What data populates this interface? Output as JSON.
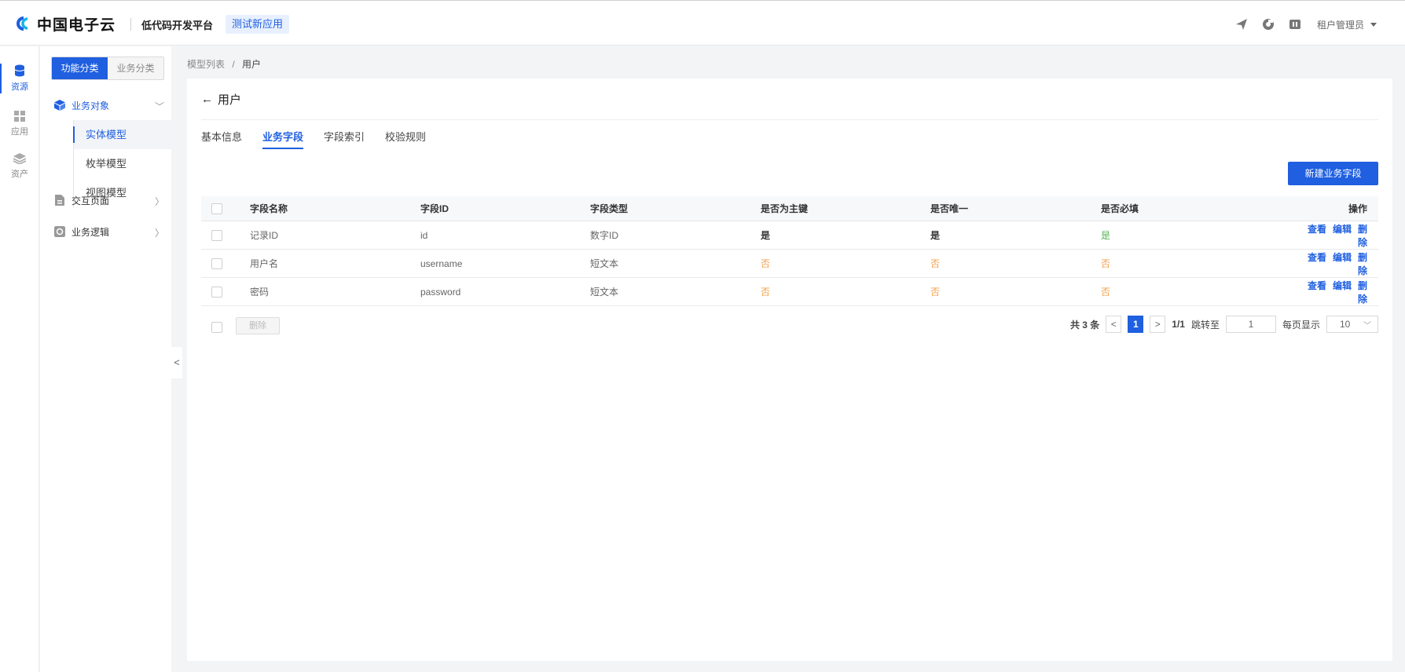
{
  "header": {
    "logo_text": "中国电子云",
    "platform": "低代码开发平台",
    "app_tag": "测试新应用",
    "user": "租户管理员",
    "icons": [
      "send-icon",
      "settings-circle-icon",
      "box-icon"
    ]
  },
  "rail": {
    "items": [
      {
        "label": "资源",
        "icon": "database-icon",
        "active": true
      },
      {
        "label": "应用",
        "icon": "grid-icon",
        "active": false
      },
      {
        "label": "资产",
        "icon": "layers-icon",
        "active": false
      }
    ]
  },
  "subnav": {
    "seg_on": "功能分类",
    "seg_off": "业务分类",
    "group_objects": "业务对象",
    "items": [
      "实体模型",
      "枚举模型",
      "视图模型"
    ],
    "group_pages": "交互页面",
    "group_logic": "业务逻辑"
  },
  "breadcrumb": {
    "parent": "模型列表",
    "sep": "/",
    "current": "用户"
  },
  "page": {
    "back_arrow": "←",
    "title": "用户",
    "tabs": [
      "基本信息",
      "业务字段",
      "字段索引",
      "校验规则"
    ],
    "new_button": "新建业务字段"
  },
  "table": {
    "headers": [
      "字段名称",
      "字段ID",
      "字段类型",
      "是否为主键",
      "是否唯一",
      "是否必填",
      "操作"
    ],
    "rows": [
      {
        "name": "记录ID",
        "id": "id",
        "type": "数字ID",
        "pk": "是",
        "unique": "是",
        "required": "是"
      },
      {
        "name": "用户名",
        "id": "username",
        "type": "短文本",
        "pk": "否",
        "unique": "否",
        "required": "否"
      },
      {
        "name": "密码",
        "id": "password",
        "type": "短文本",
        "pk": "否",
        "unique": "否",
        "required": "否"
      }
    ],
    "ops": [
      "查看",
      "编辑",
      "删除"
    ]
  },
  "footer": {
    "delete": "删除",
    "total": "共 3 条",
    "page": "1",
    "pages": "1/1",
    "jump_label": "跳转至",
    "jump_value": "1",
    "per_page_label": "每页显示",
    "per_page": "10",
    "prev": "<",
    "next": ">"
  },
  "colors": {
    "accent": "#1f5fe0",
    "no": "#f5a04b",
    "yes_green": "#52b152"
  }
}
